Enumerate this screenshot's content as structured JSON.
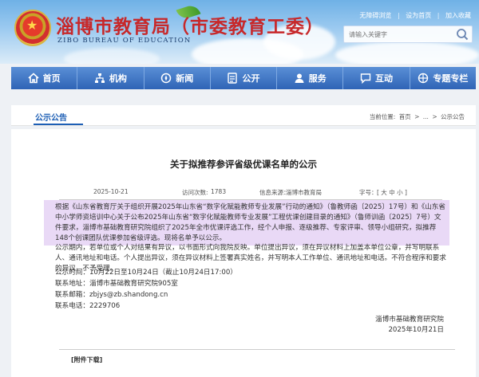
{
  "header": {
    "title": "淄博市教育局（市委教育工委）",
    "subtitle": "ZIBO BUREAU OF EDUCATION",
    "top_links": [
      "无障碍浏览",
      "设为首页",
      "加入收藏"
    ],
    "search_placeholder": "请输入关键字"
  },
  "nav": {
    "items": [
      {
        "label": "首页",
        "icon": "home-icon"
      },
      {
        "label": "机构",
        "icon": "organization-icon"
      },
      {
        "label": "新闻",
        "icon": "news-icon"
      },
      {
        "label": "公开",
        "icon": "disclosure-icon"
      },
      {
        "label": "服务",
        "icon": "service-icon"
      },
      {
        "label": "互动",
        "icon": "interaction-icon"
      },
      {
        "label": "专题专栏",
        "icon": "topics-icon"
      }
    ]
  },
  "section": {
    "label": "公示公告"
  },
  "breadcrumb": {
    "prefix": "当前位置:",
    "home": "首页",
    "sep1": ">",
    "ellipsis": "...",
    "sep2": ">",
    "current": "公示公告"
  },
  "article": {
    "title": "关于拟推荐参评省级优课名单的公示",
    "meta": {
      "date": "2025-10-21",
      "views_label": "访问次数:",
      "views": "1783",
      "source_label": "信息来源：",
      "source": "淄博市教育局",
      "font_label": "字号：",
      "font_sizes": "[ 大 中 小 ]"
    },
    "paragraph1": "根据《山东省教育厅关于组织开展2025年山东省“数字化赋能教师专业发展”行动的通知》（鲁教师函〔2025〕17号）和《山东省中小学师资培训中心关于公布2025年山东省“数字化赋能教师专业发展”工程优课创建目录的通知》（鲁师训函〔2025〕7号）文件要求，淄博市基础教育研究院组织了2025年全市优课评选工作，经个人申报、逐级推荐、专家评审、领导小组研究，拟推荐148个创课团队优课参加省级评选。现将名单予以公示。",
    "paragraph2": "公示期内，若单位或个人对结果有异议，以书面形式向我院反映。单位提出异议，须在异议材料上加盖本单位公章，并写明联系人、通讯地址和电话。个人提出异议，须在异议材料上签署真实姓名，并写明本人工作单位、通讯地址和电话。不符合程序和要求的异议，不予受理。",
    "info": [
      "公示时间：10月22日至10月24日（截止10月24日17:00）",
      "联系地址：淄博市基础教育研究院905室",
      "联系邮箱：zbjys@zb.shandong.cn",
      "联系电话：2229706"
    ],
    "signature_org": "淄博市基础教育研究院",
    "signature_date": "2025年10月21日",
    "attachment_title": "[附件下载]"
  },
  "colors": {
    "title_red": "#c7282a",
    "nav_blue": "#2f64b6",
    "highlight_purple": "#e9d9f6",
    "section_blue": "#1d5fb5"
  }
}
